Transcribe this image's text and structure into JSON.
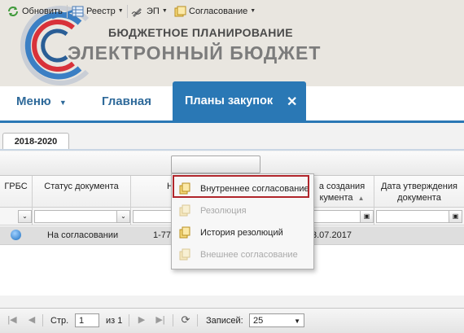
{
  "header": {
    "title_line1": "БЮДЖЕТНОЕ ПЛАНИРОВАНИЕ",
    "title_line2": "ЭЛЕКТРОННЫЙ БЮДЖЕТ"
  },
  "nav": {
    "menu_label": "Меню",
    "home_label": "Главная",
    "active_tab": "Планы закупок",
    "close_glyph": "✕"
  },
  "tabs": {
    "year_tab": "2018-2020"
  },
  "toolbar": {
    "refresh": "Обновить",
    "registry": "Реестр",
    "ep": "ЭП",
    "approval": "Согласование"
  },
  "grid": {
    "headers": {
      "grbs": "ГРБС",
      "status": "Статус документа",
      "number_partial": "Н",
      "created_line1": "а создания",
      "created_line2": "кумента",
      "approved_line1": "Дата утверждения",
      "approved_line2": "документа"
    },
    "row": {
      "status": "На согласовании",
      "number_partial": "1-77",
      "date_partial": "3.07.2017"
    }
  },
  "dropdown": {
    "items": [
      {
        "label": "Внутреннее согласование",
        "enabled": true
      },
      {
        "label": "Резолюция",
        "enabled": false
      },
      {
        "label": "История резолюций",
        "enabled": true
      },
      {
        "label": "Внешнее согласование",
        "enabled": false
      }
    ]
  },
  "paging": {
    "page_label": "Стр.",
    "page_value": "1",
    "of_total": "из 1",
    "records_label": "Записей:",
    "records_value": "25"
  },
  "colors": {
    "accent_blue": "#2a78b5",
    "highlight_red": "#b0252b"
  }
}
